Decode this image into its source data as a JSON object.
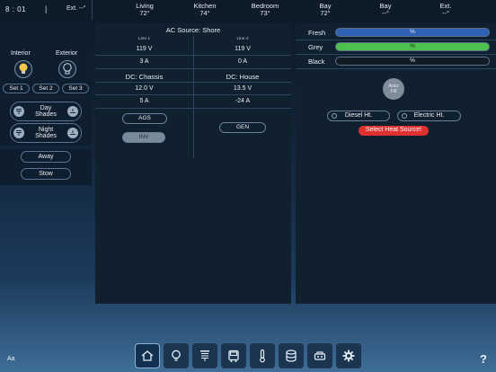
{
  "topbar": {
    "clock": "8 : 01",
    "separator": "|",
    "ext_left": "Ext. --°",
    "temps": [
      {
        "label": "Living",
        "value": "72°"
      },
      {
        "label": "Kitchen",
        "value": "74°"
      },
      {
        "label": "Bedroom",
        "value": "73°"
      },
      {
        "label": "Bay",
        "value": "72°"
      },
      {
        "label": "Bay",
        "value": "--°"
      },
      {
        "label": "Ext.",
        "value": "--°"
      }
    ]
  },
  "lights": {
    "interior_label": "Interior",
    "exterior_label": "Exterior",
    "sets": [
      "Set 1",
      "Set 2",
      "Set 3"
    ]
  },
  "shades": {
    "day": "Day Shades",
    "night": "Night Shades"
  },
  "modes": {
    "away": "Away",
    "stow": "Stow"
  },
  "power": {
    "ac_source": "AC Source: Shore",
    "line1_label": "Line 1",
    "line2_label": "Line 2",
    "line1_volts": "119 V",
    "line2_volts": "119 V",
    "line1_amps": "3 A",
    "line2_amps": "0 A",
    "dc_chassis_label": "DC: Chassis",
    "dc_house_label": "DC: House",
    "chassis_volts": "12.0 V",
    "house_volts": "13.5 V",
    "chassis_amps": "5 A",
    "house_amps": "-24 A",
    "ags": "AGS",
    "inv": "INV",
    "gen": "GEN"
  },
  "tanks": {
    "items": [
      {
        "label": "Fresh",
        "value": "%",
        "color": "#2f62b5"
      },
      {
        "label": "Grey",
        "value": "%",
        "color": "#4cc24c"
      },
      {
        "label": "Black",
        "value": "%",
        "color": "#111b25"
      }
    ],
    "auto_fill": "Auto Fill",
    "diesel": "Diesel Ht.",
    "electric": "Electric Ht.",
    "warning": "Select Heat Source!"
  },
  "footer": {
    "font_toggle": "Aa",
    "help": "?"
  },
  "nav": [
    "home-icon",
    "bulb-icon",
    "shades-icon",
    "coach-icon",
    "thermometer-icon",
    "tank-icon",
    "generator-icon",
    "gear-icon"
  ]
}
